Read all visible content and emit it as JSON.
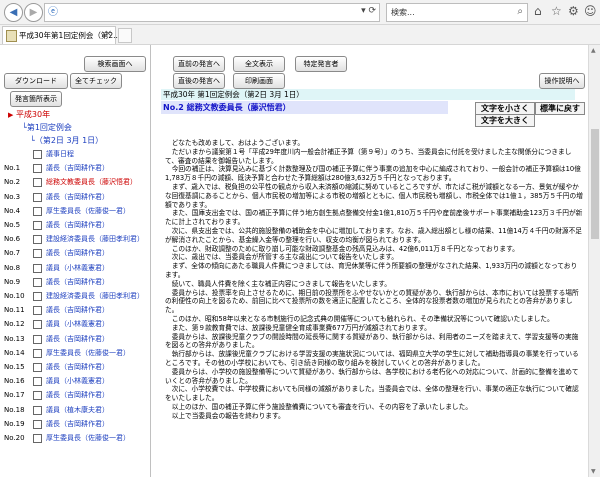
{
  "browser": {
    "back_glyph": "◀",
    "forward_glyph": "▶",
    "search_placeholder": "検索...",
    "search_glyph": "⌕",
    "tab_title": "平成30年第1回定例会（第2...",
    "tab_close": "×"
  },
  "left": {
    "buttons": {
      "search_screen": "検索画面へ",
      "download": "ダウンロード",
      "check_all": "全てチェック",
      "speaker_display": "発言箇所表示"
    },
    "tree": {
      "root": "平成30年",
      "session": "第1回定例会",
      "date": "（第2日 3月 1日）"
    },
    "items": [
      {
        "no": "",
        "label": "議事日程",
        "selected": false
      },
      {
        "no": "No.1",
        "label": "議長（吉岡耕作君）",
        "selected": false
      },
      {
        "no": "No.2",
        "label": "総務文教委員長（藤沢悟君）",
        "selected": true
      },
      {
        "no": "No.3",
        "label": "議長（吉岡耕作君）",
        "selected": false
      },
      {
        "no": "No.4",
        "label": "厚生委員長（佐藤俊一君）",
        "selected": false
      },
      {
        "no": "No.5",
        "label": "議長（吉岡耕作君）",
        "selected": false
      },
      {
        "no": "No.6",
        "label": "建設経済委員長（藤田孝利君）",
        "selected": false
      },
      {
        "no": "No.7",
        "label": "議長（吉岡耕作君）",
        "selected": false
      },
      {
        "no": "No.8",
        "label": "議員（小林義憲君）",
        "selected": false
      },
      {
        "no": "No.9",
        "label": "議長（吉岡耕作君）",
        "selected": false
      },
      {
        "no": "No.10",
        "label": "建設経済委員長（藤田孝利君）",
        "selected": false
      },
      {
        "no": "No.11",
        "label": "議長（吉岡耕作君）",
        "selected": false
      },
      {
        "no": "No.12",
        "label": "議員（小林義憲君）",
        "selected": false
      },
      {
        "no": "No.13",
        "label": "議長（吉岡耕作君）",
        "selected": false
      },
      {
        "no": "No.14",
        "label": "厚生委員長（佐藤俊一君）",
        "selected": false
      },
      {
        "no": "No.15",
        "label": "議長（吉岡耕作君）",
        "selected": false
      },
      {
        "no": "No.16",
        "label": "議員（小林義憲君）",
        "selected": false
      },
      {
        "no": "No.17",
        "label": "議長（吉岡耕作君）",
        "selected": false
      },
      {
        "no": "No.18",
        "label": "議員（植木康夫君）",
        "selected": false
      },
      {
        "no": "No.19",
        "label": "議長（吉岡耕作君）",
        "selected": false
      },
      {
        "no": "No.20",
        "label": "厚生委員長（佐藤俊一君）",
        "selected": false
      }
    ]
  },
  "right": {
    "buttons": {
      "prev": "直前の発言へ",
      "show_all": "全文表示",
      "specific": "特定発言者",
      "next": "直後の発言へ",
      "print": "印刷画面",
      "help": "操作説明へ"
    },
    "header_title": "平成30年 第1回定例会（第2日 3月 1日）",
    "speech_title": "No.2 総務文教委員長（藤沢悟君）",
    "font_buttons": {
      "smaller": "文字を小さく",
      "normal": "標準に戻す",
      "larger": "文字を大きく"
    },
    "body": [
      "どなたも改めまして、おはようございます。",
      "ただいまから議案第１号「平成29年度川内一般会計補正予算（第９号）」のうち、当委員会に付託を受けました主な関係分につきまして、審査の結果を御報告いたします。",
      "今回の補正は、決算見込みに基づく計数整理及び国の補正予算に伴う事業の追加を中心に編成されており、一般会計の補正予算額は10億1,783万８千円の減額、既決予算と合わせた予算総額は280億3,632万５千円となっております。",
      "まず、歳入では、税負担の公平性の観点から収入未済額の縮減に努めているところですが、市たばこ税が減額となる一方、景気が緩やかな回復基調にあることから、個人市民税の増加等による市税の増額とともに、個人市民税も増額し、市税全体では1億１，385万５千円の増額であります。",
      "また、国庫支出金では、国の補正予算に伴う地方創生拠点整備交付金1億1,810万５千円や産前産後サポート事業補助金123万３千円が新たに計上されております。",
      "次に、県支出金では、公共的施設整備の補助金を中心に増加しております。なお、歳入総出額とし様の結果、11億14万４千円の財源不足が解消されたことから、基金繰入金等の整理を行い、収支の均衡が図られております。",
      "このほか、財政調整のために取り崩し可能な財政調整基金の残高見込みは、42億6,011万８千円となっております。",
      "次に、歳出では、当委員会が所管する主な歳出について報告をいたします。",
      "まず、全体の傾向にあたる職員人件費につきましては、育児休業等に伴う所要額の整理がなされた結果、1,933万円の減額となっております。",
      "続いて、職員人件費を除く主な補正内容につきまして報告をいたします。",
      "委員からは、投票率を向上させるために、期日前の投票所をふやせないかとの質疑があり、執行部からは、本市においては投票する場所の利便性の向上を図るため、前回に比べて投票所の数を適正に配置したところ、全体的な投票者数の増加が見られたとの答弁がありました。",
      "このほか、昭和58年以来となる市制施行の記念式典の開催等についても触れられ、その準備状況等について確認いたしました。",
      "また、第９款教育費では、放課後児童健全育成事業費677万円が減額されております。",
      "委員からは、放課後児童クラブの開設時間の延長等に関する質疑があり、執行部からは、利用者のニーズを踏まえて、学習支援等の実施を図るとの答弁がありました。",
      "執行部からは、放課後児童クラブにおける学習支援の実施状況については、福岡県立大学の学生に対して補助指導員の事業を行っているところです。その他の小学校においても、引き続き同様の取り組みを検討していくとの答弁がありました。",
      "委員からは、小学校の施設整備等について質疑があり、執行部からは、各学校における老朽化への対応について、計画的に整備を進めていくとの答弁がありました。",
      "次に、小学校費では、中学校費においても同様の減額がありました。当委員会では、全体の整理を行い、事業の適正な執行について確認をいたしました。",
      "以上のほか、国の補正予算に伴う施設整備費についても審査を行い、その内容を了承いたしました。",
      "以上で当委員会の報告を終わります。"
    ]
  }
}
